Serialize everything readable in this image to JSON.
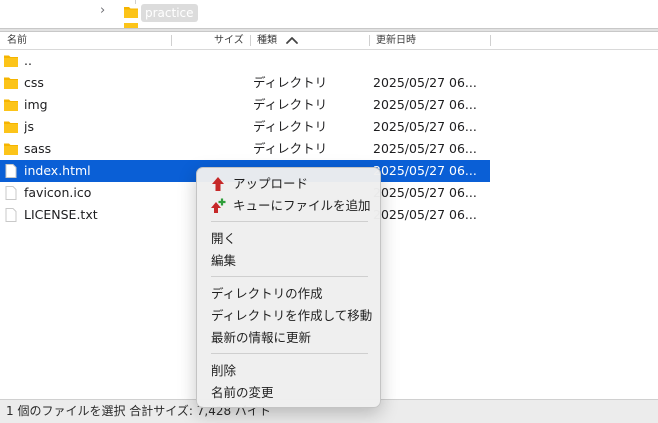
{
  "tree": {
    "selected_folder": "practice"
  },
  "header": {
    "name": "名前",
    "size": "サイズ",
    "type": "種類",
    "modified": "更新日時"
  },
  "files": [
    {
      "name": "..",
      "size": "",
      "type": "",
      "modified": "",
      "icon": "folder-icon"
    },
    {
      "name": "css",
      "size": "",
      "type": "ディレクトリ",
      "modified": "2025/05/27 06...",
      "icon": "folder-icon"
    },
    {
      "name": "img",
      "size": "",
      "type": "ディレクトリ",
      "modified": "2025/05/27 06...",
      "icon": "folder-icon"
    },
    {
      "name": "js",
      "size": "",
      "type": "ディレクトリ",
      "modified": "2025/05/27 06...",
      "icon": "folder-icon"
    },
    {
      "name": "sass",
      "size": "",
      "type": "ディレクトリ",
      "modified": "2025/05/27 06...",
      "icon": "folder-icon"
    },
    {
      "name": "index.html",
      "size": "",
      "type": "",
      "modified": "2025/05/27 06...",
      "icon": "file-icon"
    },
    {
      "name": "favicon.ico",
      "size": "",
      "type": "",
      "modified": "2025/05/27 06...",
      "icon": "file-icon"
    },
    {
      "name": "LICENSE.txt",
      "size": "",
      "type": "",
      "modified": "2025/05/27 06...",
      "icon": "file-icon"
    }
  ],
  "context_menu": {
    "upload": "アップロード",
    "add_to_queue": "キューにファイルを追加",
    "open": "開く",
    "edit": "編集",
    "create_dir": "ディレクトリの作成",
    "create_dir_enter": "ディレクトリを作成して移動",
    "refresh": "最新の情報に更新",
    "delete": "削除",
    "rename": "名前の変更"
  },
  "status": {
    "text": "1 個のファイルを選択 合計サイズ: 7,428 バイト"
  },
  "colors": {
    "selection": "#0a5fd6",
    "folder": "#f5b400",
    "upload_arrow": "#c62828",
    "queue_plus": "#2e9e3a"
  }
}
